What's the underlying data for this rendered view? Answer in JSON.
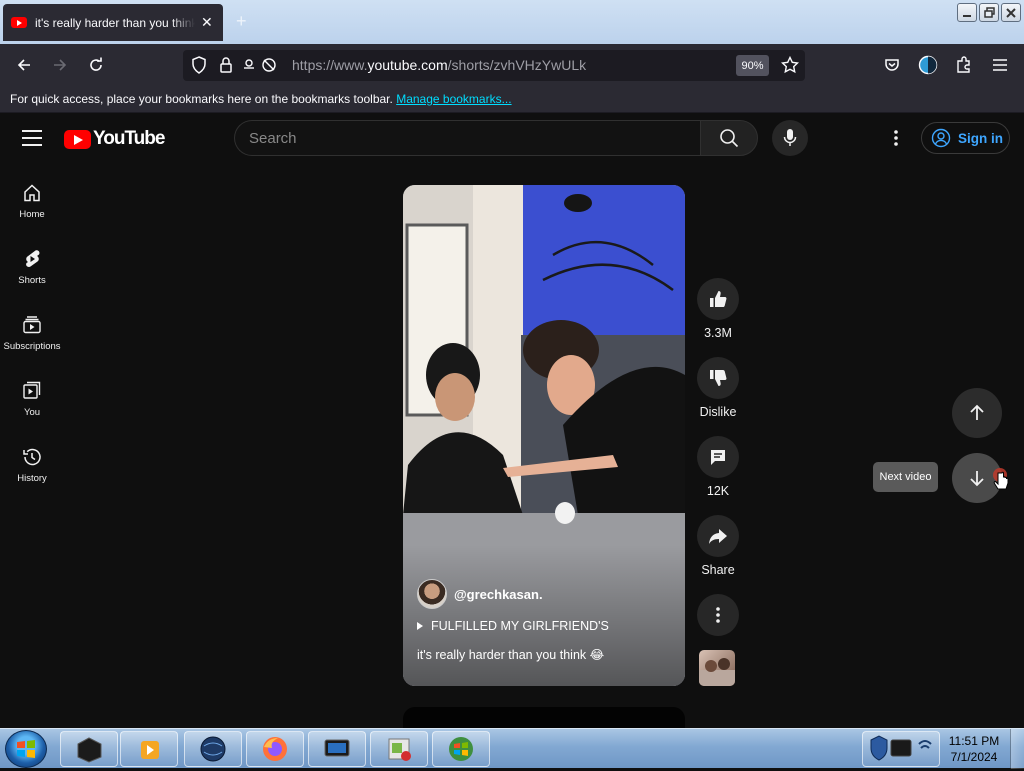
{
  "browser": {
    "tab_title": "it's really harder than you think",
    "tab_close": "✕",
    "new_tab": "+",
    "url_prefix": "https://www.",
    "url_domain": "youtube.com",
    "url_path": "/shorts/zvhVHzYwULk",
    "zoom": "90%",
    "bookmarks_text": "For quick access, place your bookmarks here on the bookmarks toolbar.",
    "bookmarks_link": "Manage bookmarks..."
  },
  "youtube": {
    "search_placeholder": "Search",
    "sign_in": "Sign in",
    "sidebar": [
      {
        "label": "Home",
        "icon": "home-icon"
      },
      {
        "label": "Shorts",
        "icon": "shorts-icon"
      },
      {
        "label": "Subscriptions",
        "icon": "subscriptions-icon"
      },
      {
        "label": "You",
        "icon": "you-icon"
      },
      {
        "label": "History",
        "icon": "history-icon"
      }
    ],
    "short": {
      "channel": "@grechkasan.",
      "title": "FULFILLED MY GIRLFRIEND'S",
      "description": "it's really harder than you think 😂"
    },
    "actions": {
      "likes": "3.3M",
      "dislike": "Dislike",
      "comments": "12K",
      "share": "Share"
    },
    "tooltip": "Next video"
  },
  "taskbar": {
    "time": "11:51 PM",
    "date": "7/1/2024"
  },
  "colors": {
    "yt_red": "#ff0000",
    "link_blue": "#3ea6ff",
    "page_bg": "#0f0f0f"
  }
}
